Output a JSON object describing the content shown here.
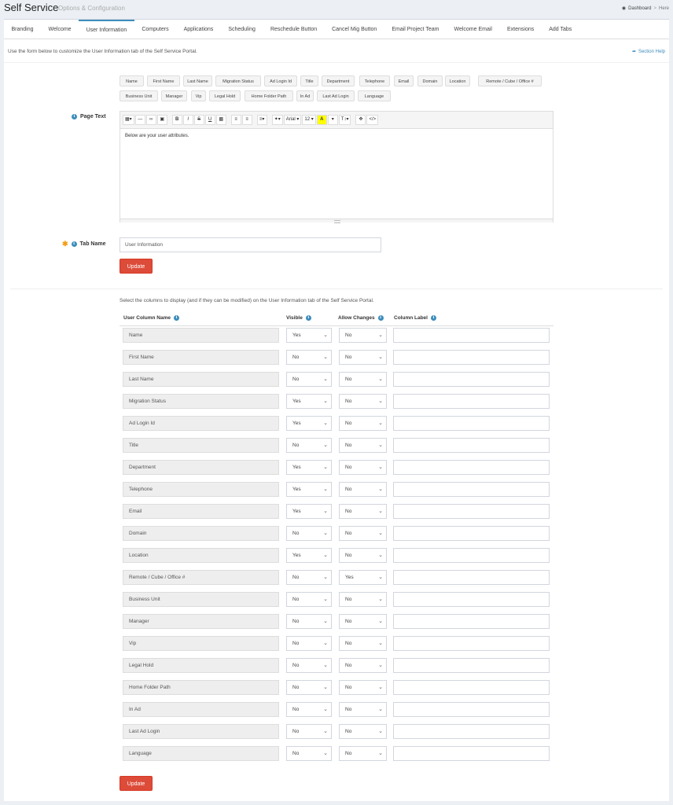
{
  "header": {
    "title": "Self Service",
    "subtitle": "Options & Configuration",
    "breadcrumb": [
      "Dashboard",
      "Here"
    ]
  },
  "tabs": [
    {
      "label": "Branding",
      "active": false
    },
    {
      "label": "Welcome",
      "active": false
    },
    {
      "label": "User Information",
      "active": true
    },
    {
      "label": "Computers",
      "active": false
    },
    {
      "label": "Applications",
      "active": false
    },
    {
      "label": "Scheduling",
      "active": false
    },
    {
      "label": "Reschedule Button",
      "active": false
    },
    {
      "label": "Cancel Mig Button",
      "active": false
    },
    {
      "label": "Email Project Team",
      "active": false
    },
    {
      "label": "Welcome Email",
      "active": false
    },
    {
      "label": "Extensions",
      "active": false
    },
    {
      "label": "Add Tabs",
      "active": false
    }
  ],
  "intro": {
    "text": "Use the form below to customize the User Information tab of the Self Service Portal.",
    "help_label": "Section Help"
  },
  "tokens": [
    "Name",
    "First Name",
    "Last Name",
    "Migration Status",
    "Ad Login Id",
    "Title",
    "Department",
    "Telephone",
    "Email",
    "Domain",
    "Location",
    "Remote / Cube / Office #",
    "Business Unit",
    "Manager",
    "Vip",
    "Legal Hold",
    "Home Folder Path",
    "In Ad",
    "Last Ad Login",
    "Language"
  ],
  "page_text": {
    "label": "Page Text",
    "toolbar": {
      "font": "Arial ▾",
      "size": "12 ▾"
    },
    "content": "Below are your user attributes."
  },
  "tab_name": {
    "label": "Tab Name",
    "value": "User Information"
  },
  "update_label": "Update",
  "columns": {
    "intro": "Select the columns to display (and if they can be modified) on the User Information tab of the Self Service Portal.",
    "headers": {
      "name": "User Column Name",
      "visible": "Visible",
      "allow": "Allow Changes",
      "label": "Column Label"
    },
    "rows": [
      {
        "name": "Name",
        "visible": "Yes",
        "allow": "No"
      },
      {
        "name": "First Name",
        "visible": "No",
        "allow": "No"
      },
      {
        "name": "Last Name",
        "visible": "No",
        "allow": "No"
      },
      {
        "name": "Migration Status",
        "visible": "Yes",
        "allow": "No"
      },
      {
        "name": "Ad Login Id",
        "visible": "Yes",
        "allow": "No"
      },
      {
        "name": "Title",
        "visible": "No",
        "allow": "No"
      },
      {
        "name": "Department",
        "visible": "Yes",
        "allow": "No"
      },
      {
        "name": "Telephone",
        "visible": "Yes",
        "allow": "No"
      },
      {
        "name": "Email",
        "visible": "Yes",
        "allow": "No"
      },
      {
        "name": "Domain",
        "visible": "No",
        "allow": "No"
      },
      {
        "name": "Location",
        "visible": "Yes",
        "allow": "No"
      },
      {
        "name": "Remote / Cube / Office #",
        "visible": "No",
        "allow": "Yes"
      },
      {
        "name": "Business Unit",
        "visible": "No",
        "allow": "No"
      },
      {
        "name": "Manager",
        "visible": "No",
        "allow": "No"
      },
      {
        "name": "Vip",
        "visible": "No",
        "allow": "No"
      },
      {
        "name": "Legal Hold",
        "visible": "No",
        "allow": "No"
      },
      {
        "name": "Home Folder Path",
        "visible": "No",
        "allow": "No"
      },
      {
        "name": "In Ad",
        "visible": "No",
        "allow": "No"
      },
      {
        "name": "Last Ad Login",
        "visible": "No",
        "allow": "No"
      },
      {
        "name": "Language",
        "visible": "No",
        "allow": "No"
      }
    ]
  },
  "colors": {
    "accent": "#3c8dbc",
    "danger": "#dd4b39",
    "warning": "#f39c12"
  }
}
